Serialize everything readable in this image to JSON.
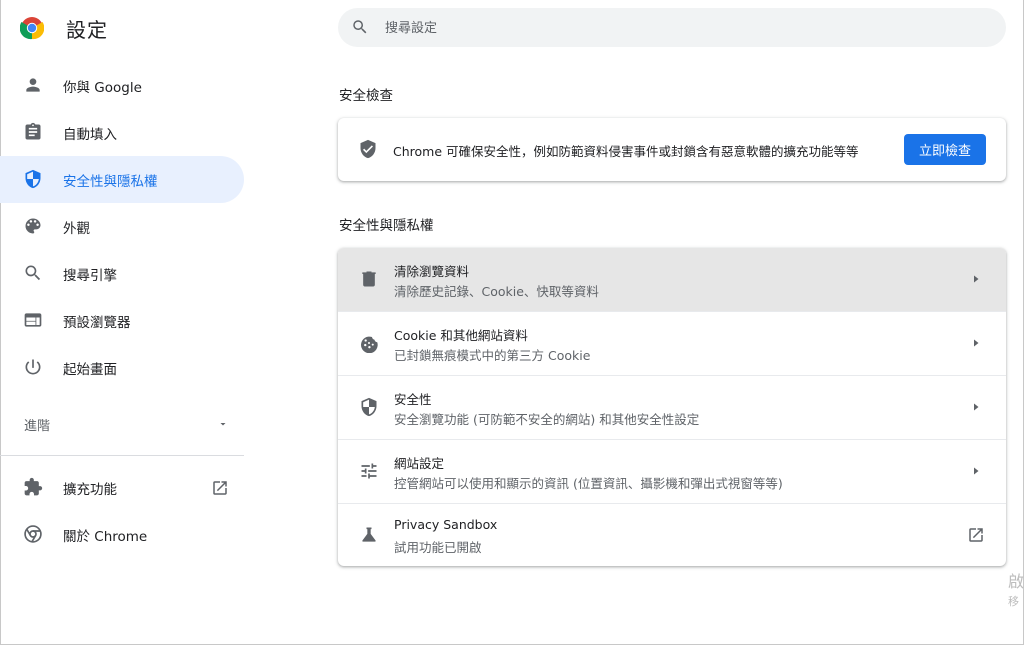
{
  "app": {
    "title": "設定"
  },
  "sidebar": {
    "items": [
      {
        "label": "你與 Google",
        "icon": "person-icon"
      },
      {
        "label": "自動填入",
        "icon": "clipboard-icon"
      },
      {
        "label": "安全性與隱私權",
        "icon": "shield-icon",
        "active": true
      },
      {
        "label": "外觀",
        "icon": "palette-icon"
      },
      {
        "label": "搜尋引擎",
        "icon": "search-icon"
      },
      {
        "label": "預設瀏覽器",
        "icon": "browser-icon"
      },
      {
        "label": "起始畫面",
        "icon": "power-icon"
      }
    ],
    "advanced_label": "進階",
    "bottom_items": [
      {
        "label": "擴充功能",
        "icon": "puzzle-icon"
      },
      {
        "label": "關於 Chrome",
        "icon": "chrome-icon"
      }
    ]
  },
  "search": {
    "placeholder": "搜尋設定"
  },
  "safety_check": {
    "section_title": "安全檢查",
    "text": "Chrome 可確保安全性，例如防範資料侵害事件或封鎖含有惡意軟體的擴充功能等等",
    "button_label": "立即檢查"
  },
  "privacy": {
    "section_title": "安全性與隱私權",
    "rows": [
      {
        "title": "清除瀏覽資料",
        "subtitle": "清除歷史記錄、Cookie、快取等資料",
        "icon": "trash-icon"
      },
      {
        "title": "Cookie 和其他網站資料",
        "subtitle": "已封鎖無痕模式中的第三方 Cookie",
        "icon": "cookie-icon"
      },
      {
        "title": "安全性",
        "subtitle": "安全瀏覽功能 (可防範不安全的網站) 和其他安全性設定",
        "icon": "shield-icon"
      },
      {
        "title": "網站設定",
        "subtitle": "控管網站可以使用和顯示的資訊 (位置資訊、攝影機和彈出式視窗等等)",
        "icon": "tune-icon"
      },
      {
        "title": "Privacy Sandbox",
        "subtitle": "試用功能已開啟",
        "icon": "flask-icon"
      }
    ]
  },
  "overflow": {
    "line1": "啟",
    "line2": "移"
  },
  "colors": {
    "accent": "#1a73e8",
    "active_bg": "#e8f0fe",
    "hover_row": "#e6e6e6"
  }
}
